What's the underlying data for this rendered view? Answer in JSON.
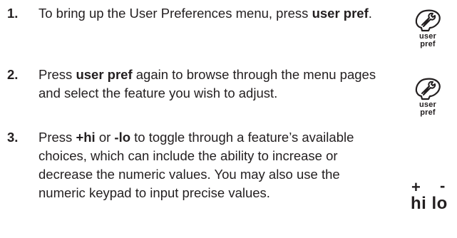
{
  "steps": [
    {
      "number": "1.",
      "text_before": "To bring up the User Preferences menu, press ",
      "bold": "user pref",
      "text_after": "."
    },
    {
      "number": "2.",
      "text_before": "Press ",
      "bold": "user pref",
      "text_after": " again to browse through the menu pages and select the feature you wish to adjust."
    },
    {
      "number": "3.",
      "text_before": "Press ",
      "bold1": "+hi",
      "text_mid": " or ",
      "bold2": "-lo",
      "text_after": " to toggle through a feature’s available choices, which can include the ability to increase or decrease the numeric values. You may also use the numeric keypad to input precise values."
    }
  ],
  "icons": {
    "user_pref": {
      "icon": "wrench-icon",
      "line1": "user",
      "line2": "pref"
    },
    "hilo": {
      "plus": "+",
      "minus": "-",
      "label": "hi lo"
    }
  }
}
